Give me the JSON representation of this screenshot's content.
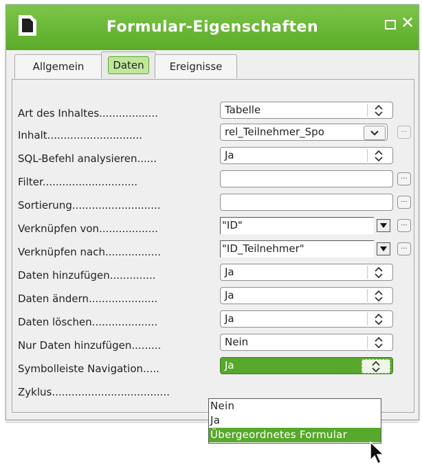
{
  "window": {
    "title": "Formular-Eigenschaften"
  },
  "tabs": [
    {
      "label": "Allgemein"
    },
    {
      "label": "Daten"
    },
    {
      "label": "Ereignisse"
    }
  ],
  "rows": [
    {
      "label": "Art des Inhaltes..................",
      "value": "Tabelle"
    },
    {
      "label": "Inhalt.............................",
      "value": "rel_Teilnehmer_Spo"
    },
    {
      "label": "SQL-Befehl analysieren......",
      "value": "Ja"
    },
    {
      "label": "Filter.............................",
      "value": ""
    },
    {
      "label": "Sortierung...........................",
      "value": ""
    },
    {
      "label": "Verknüpfen von..................",
      "value": "\"ID\""
    },
    {
      "label": "Verknüpfen nach.................",
      "value": "\"ID_Teilnehmer\""
    },
    {
      "label": "Daten hinzufügen..............",
      "value": "Ja"
    },
    {
      "label": "Daten ändern.....................",
      "value": "Ja"
    },
    {
      "label": "Daten löschen....................",
      "value": "Ja"
    },
    {
      "label": "Nur Daten hinzufügen.........",
      "value": "Nein"
    },
    {
      "label": "Symbolleiste Navigation.....",
      "value": "Ja"
    },
    {
      "label": "Zyklus....................................",
      "value": ""
    }
  ],
  "dropdown": {
    "options": [
      "Nein",
      "Ja",
      "Übergeordnetes Formular"
    ],
    "highlighted": "Übergeordnetes Formular"
  },
  "colors": {
    "accent": "#5aaa28",
    "selection": "#57a82b"
  },
  "icons": [
    "app-icon",
    "maximize-icon",
    "close-icon",
    "spin-arrows-icon",
    "combo-chevron-icon",
    "ellipsis-icon",
    "mouse-pointer-icon"
  ]
}
